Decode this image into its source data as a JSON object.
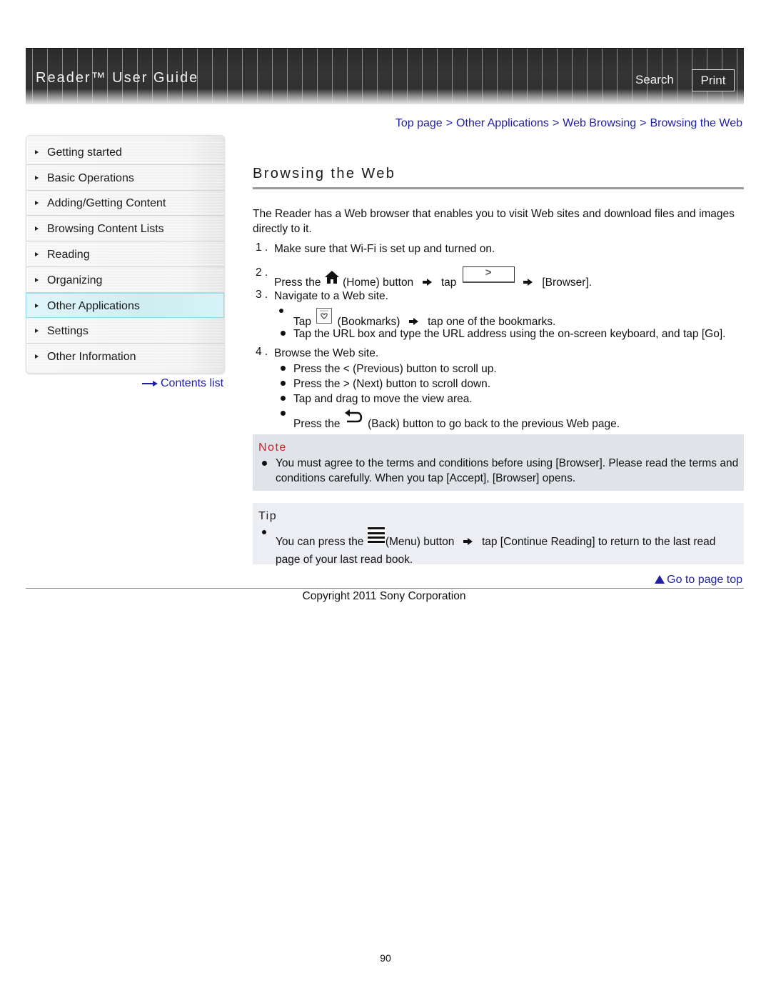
{
  "header": {
    "title": "Reader™ User Guide",
    "search_label": "Search",
    "print_label": "Print"
  },
  "breadcrumb": {
    "items": [
      "Top page",
      "Other Applications",
      "Web Browsing",
      "Browsing the Web"
    ],
    "separator": ">"
  },
  "sidebar": {
    "items": [
      {
        "label": "Getting started",
        "active": false
      },
      {
        "label": "Basic Operations",
        "active": false
      },
      {
        "label": "Adding/Getting Content",
        "active": false
      },
      {
        "label": "Browsing Content Lists",
        "active": false
      },
      {
        "label": "Reading",
        "active": false
      },
      {
        "label": "Organizing",
        "active": false
      },
      {
        "label": "Other Applications",
        "active": true
      },
      {
        "label": "Settings",
        "active": false
      },
      {
        "label": "Other Information",
        "active": false
      }
    ],
    "contents_link": "Contents list"
  },
  "main": {
    "title": "Browsing the Web",
    "intro": "The Reader has a Web browser that enables you to visit Web sites and download files and images directly to it.",
    "steps": [
      {
        "num": "1 .",
        "text": "Make sure that Wi-Fi is set up and turned on."
      },
      {
        "num": "2 .",
        "parts": [
          "Press the",
          "(Home) button",
          "tap",
          "[Browser]."
        ]
      },
      {
        "num": "3 .",
        "text": "Navigate to a Web site.",
        "bullets": [
          {
            "parts": [
              "Tap",
              "(Bookmarks)",
              "tap one of the bookmarks."
            ]
          },
          {
            "text": "Tap the URL box and type the URL address using the on-screen keyboard, and tap [Go]."
          }
        ]
      },
      {
        "num": "4 .",
        "text": "Browse the Web site.",
        "bullets": [
          {
            "text": "Press the < (Previous) button to scroll up."
          },
          {
            "text": "Press the > (Next) button to scroll down."
          },
          {
            "text": "Tap and drag to move the view area."
          },
          {
            "parts": [
              "Press the",
              "(Back) button to go back to the previous Web page."
            ]
          }
        ]
      }
    ],
    "icons": {
      "home": "home-icon",
      "next_button": "next-button-icon",
      "bookmarks": "bookmarks-icon",
      "back": "back-icon",
      "menu": "menu-icon",
      "arrow": "right-arrow-icon"
    },
    "next_button_glyph": ">"
  },
  "note": {
    "heading": "Note",
    "text": "You must agree to the terms and conditions before using [Browser]. Please read the terms and conditions carefully. When you tap [Accept], [Browser] opens.",
    "heading_color": "#d2232a"
  },
  "tip": {
    "heading": "Tip",
    "parts": [
      "You can press the",
      "(Menu) button",
      "tap [Continue Reading] to return to the last read page of your last read book."
    ]
  },
  "footer": {
    "go_top": "Go to page top",
    "copyright": "Copyright 2011 Sony Corporation",
    "page_number": "90"
  },
  "colors": {
    "link": "#1f1fa0",
    "active_nav_bg": "#d6f3f7",
    "note_bg": "#e0e3e8",
    "tip_bg": "#eceef4"
  }
}
